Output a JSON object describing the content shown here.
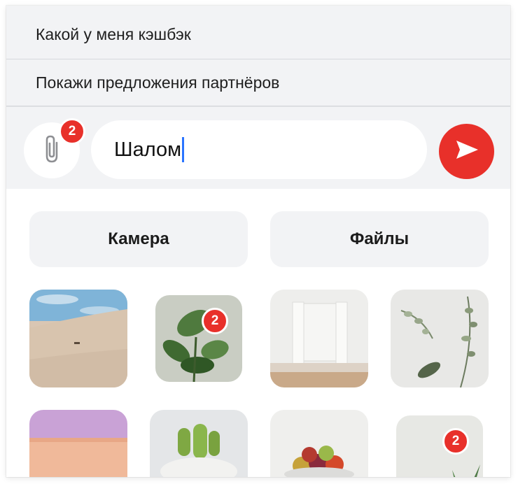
{
  "suggestions": [
    {
      "label": "Какой у меня кэшбэк"
    },
    {
      "label": "Покажи предложения партнёров"
    }
  ],
  "composer": {
    "attachment_count": "2",
    "message_text": "Шалом",
    "accent_color": "#e8302a",
    "caret_color": "#2a74ff"
  },
  "actions": {
    "camera_label": "Камера",
    "files_label": "Файлы"
  },
  "gallery": {
    "selected_badges": [
      "2",
      "2"
    ]
  }
}
